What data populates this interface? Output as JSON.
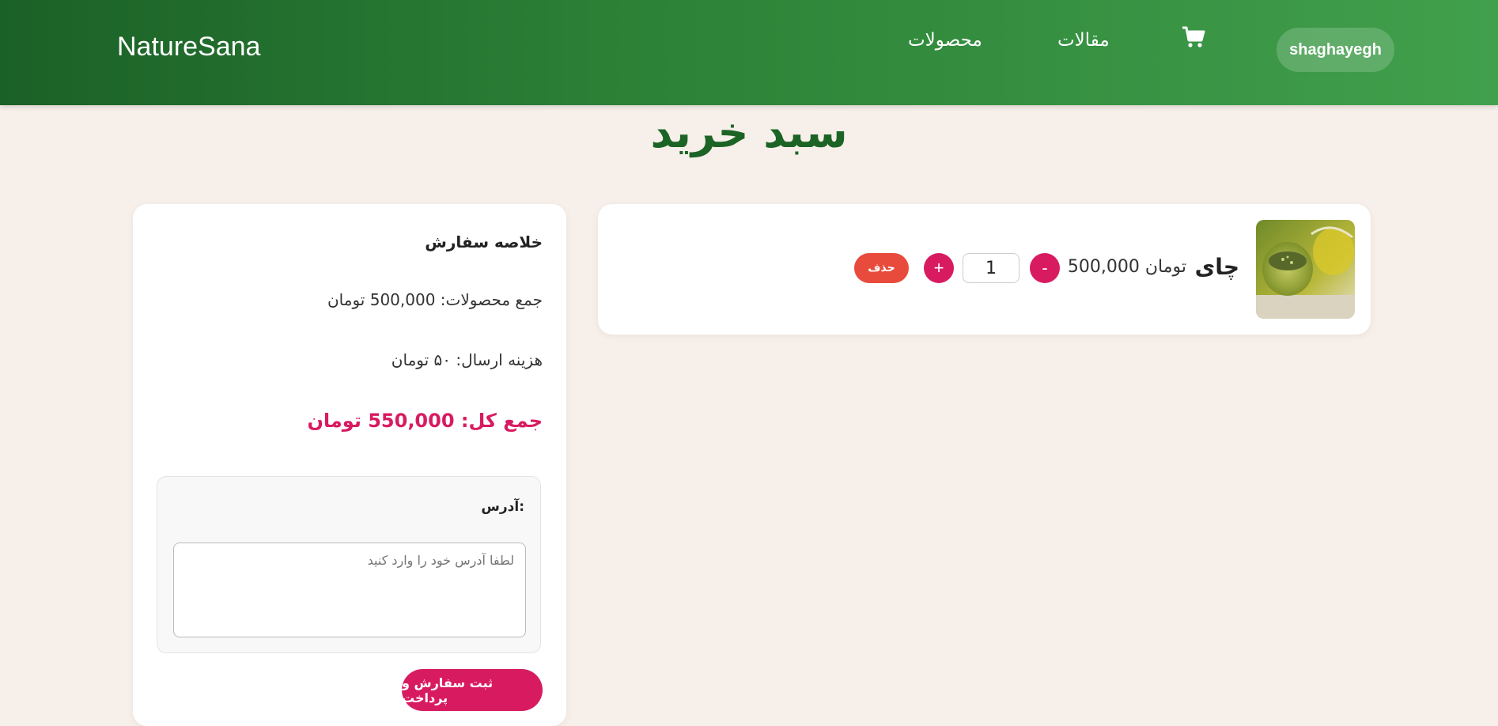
{
  "header": {
    "brand": "NatureSana",
    "nav_products": "محصولات",
    "nav_articles": "مقالات",
    "cart_icon": "cart-icon",
    "username": "shaghayegh"
  },
  "page": {
    "title": "سبد خرید"
  },
  "cart": {
    "items": [
      {
        "name": "چای",
        "price": "500,000 تومان",
        "quantity": "1",
        "minus_label": "-",
        "plus_label": "+",
        "delete_label": "حذف",
        "image_icon": "tea-image"
      }
    ]
  },
  "summary": {
    "title": "خلاصه سفارش",
    "products_total": "جمع محصولات: 500,000 تومان",
    "shipping": "هزینه ارسال: ۵۰ تومان",
    "grand_total": "جمع کل: 550,000 تومان",
    "address_label": "آدرس:",
    "address_placeholder": "لطفا آدرس خود را وارد کنید",
    "address_value": "",
    "submit_label": "ثبت سفارش و پرداخت"
  },
  "colors": {
    "header_dark": "#1b6127",
    "header_light": "#41a04c",
    "accent": "#d81b60",
    "delete": "#e84b3c",
    "background": "#f7efe9",
    "title_green": "#1c6425"
  }
}
